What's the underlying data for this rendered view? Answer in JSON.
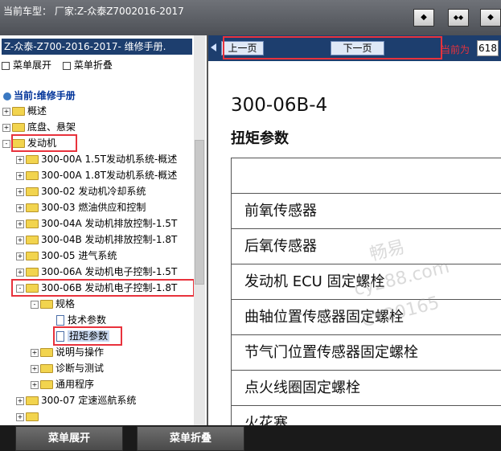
{
  "header": {
    "vehicle_text": "当前车型：  厂家:Z-众泰Z7002016-2017",
    "buttons": [
      {
        "icon": "window-single-icon",
        "glyph": "◆"
      },
      {
        "icon": "window-split-icon",
        "glyph": "◆◆"
      },
      {
        "icon": "window-right-icon",
        "glyph": "◆"
      }
    ]
  },
  "sidebar": {
    "title": "Z-众泰-Z700-2016-2017- 维修手册.",
    "expand_label": "菜单展开",
    "collapse_label": "菜单折叠",
    "current_label": "当前:维修手册",
    "tree": [
      {
        "label": "概述",
        "expander": "+"
      },
      {
        "label": "底盘、悬架",
        "expander": "+"
      },
      {
        "label": "发动机",
        "expander": "-"
      },
      {
        "label": "300-00A 1.5T发动机系统-概述",
        "expander": "+"
      },
      {
        "label": "300-00A 1.8T发动机系统-概述",
        "expander": "+"
      },
      {
        "label": "300-02 发动机冷却系统",
        "expander": "+"
      },
      {
        "label": "300-03 燃油供应和控制",
        "expander": "+"
      },
      {
        "label": "300-04A 发动机排放控制-1.5T",
        "expander": "+"
      },
      {
        "label": "300-04B 发动机排放控制-1.8T",
        "expander": "+"
      },
      {
        "label": "300-05 进气系统",
        "expander": "+"
      },
      {
        "label": "300-06A 发动机电子控制-1.5T",
        "expander": "+"
      },
      {
        "label": "300-06B 发动机电子控制-1.8T",
        "expander": "-"
      },
      {
        "label": "规格",
        "expander": "-"
      },
      {
        "label": "技术参数",
        "expander": ""
      },
      {
        "label": "扭矩参数",
        "expander": ""
      },
      {
        "label": "说明与操作",
        "expander": "+"
      },
      {
        "label": "诊断与测试",
        "expander": "+"
      },
      {
        "label": "通用程序",
        "expander": "+"
      },
      {
        "label": "300-07 定速巡航系统",
        "expander": "+"
      },
      {
        "label": "",
        "expander": "+"
      }
    ]
  },
  "pager": {
    "prev_label": "上一页",
    "next_label": "下一页",
    "current_label": "当前为",
    "current_page": "618"
  },
  "document": {
    "section_number": "300-06B-4",
    "heading": "扭矩参数",
    "rows": [
      "",
      "前氧传感器",
      "后氧传感器",
      "发动机 ECU 固定螺栓",
      "曲轴位置传感器固定螺栓",
      "节气门位置传感器固定螺栓",
      "点火线圈固定螺栓",
      "火花塞"
    ],
    "watermark": [
      "畅易",
      "cy288.com",
      "CY20165"
    ]
  },
  "footer": {
    "expand_label": "菜单展开",
    "collapse_label": "菜单折叠"
  },
  "colors": {
    "highlight_box": "#e8323c",
    "title_bar": "#1d3e6e"
  }
}
